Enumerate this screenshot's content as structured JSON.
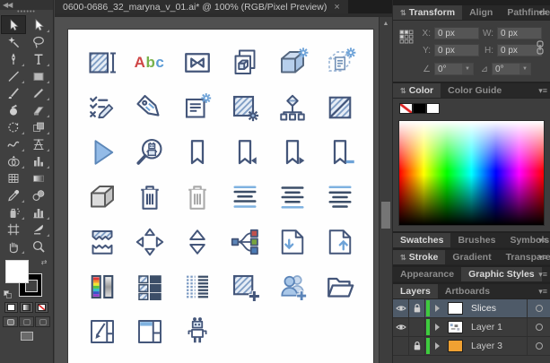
{
  "tab_bar": {
    "title": "0600-0686_32_maryna_v_01.ai* @ 100% (RGB/Pixel Preview)",
    "close": "×"
  },
  "glyphs": {
    "collapse_left": "◀◀",
    "grip": "••••••",
    "panel_collapse": "⇅",
    "panel_menu": "▾≡",
    "scroll_up": "▲",
    "dropdown": "▼",
    "rotate_glyph": "∠",
    "shear_glyph": "⊿",
    "swap": "⇄"
  },
  "toolbar": {
    "active_tool": "selection",
    "tools": [
      "selection",
      "direct-selection",
      "magic-wand",
      "lasso",
      "pen",
      "type",
      "line-segment",
      "rectangle",
      "paintbrush",
      "pencil",
      "blob-brush",
      "eraser",
      "rotate",
      "free-transform",
      "width",
      "perspective-grid",
      "shape-builder",
      "column-graph",
      "mesh",
      "gradient",
      "eyedropper",
      "blend",
      "symbol-sprayer",
      "graph",
      "artboard",
      "slice",
      "hand",
      "zoom"
    ],
    "fill_color": "#ffffff",
    "stroke_color": "#000000"
  },
  "canvas": {
    "abc": {
      "a": "A",
      "b": "b",
      "c": "c"
    },
    "icons": [
      "artboard-measure",
      "text-abc",
      "bowtie-frame",
      "duplicate-pages",
      "cube-settings",
      "cube-document-settings",
      "task-list-edit",
      "tag-edit",
      "document-settings",
      "swatch-settings",
      "hierarchy",
      "swatch-disabled",
      "play",
      "search-robot",
      "bookmark",
      "bookmark-previous",
      "bookmark-next",
      "bookmark-remove",
      "cube-3d",
      "trash",
      "trash-disabled",
      "align-center-selected",
      "align-center-underline",
      "align-center-topline",
      "page-break",
      "move",
      "collapse-vertical",
      "split-channels",
      "page-download",
      "page-upload",
      "color-bars",
      "tile-grid",
      "line-pattern",
      "swatch-add",
      "users-add",
      "folder-open",
      "scale-window",
      "layout-panels",
      "robot"
    ]
  },
  "panels": {
    "transform": {
      "tabs": [
        "Transform",
        "Align",
        "Pathfinder"
      ],
      "active": "Transform",
      "x_label": "X:",
      "x_value": "0 px",
      "y_label": "Y:",
      "y_value": "0 px",
      "w_label": "W:",
      "w_value": "0 px",
      "h_label": "H:",
      "h_value": "0 px",
      "rotate_value": "0°",
      "shear_value": "0°"
    },
    "color": {
      "tabs": [
        "Color",
        "Color Guide"
      ],
      "active": "Color"
    },
    "swatches_bar": {
      "tabs": [
        "Swatches",
        "Brushes",
        "Symbols"
      ],
      "active": "Swatches"
    },
    "stroke_bar": {
      "tabs": [
        "Stroke",
        "Gradient",
        "Transparency"
      ],
      "active": "Stroke"
    },
    "appearance_bar": {
      "tabs": [
        "Appearance",
        "Graphic Styles"
      ],
      "active": "Graphic Styles"
    },
    "layers": {
      "tabs": [
        "Layers",
        "Artboards"
      ],
      "active": "Layers",
      "rows": [
        {
          "name": "Slices",
          "visible": true,
          "locked": true,
          "selected": true,
          "color": "#3ecb3e",
          "thumb": "white"
        },
        {
          "name": "Layer 1",
          "visible": true,
          "locked": false,
          "selected": false,
          "color": "#3ecb3e",
          "thumb": "art"
        },
        {
          "name": "Layer 3",
          "visible": false,
          "locked": true,
          "selected": false,
          "color": "#3ecb3e",
          "thumb": "#f0a132"
        }
      ]
    }
  },
  "colors": {
    "ui_bg": "#3f3f3f",
    "panel_bg": "#3d3d3d",
    "strip_bg": "#282828",
    "selected_row": "#4e5a68",
    "layer_green": "#3ecb3e",
    "layer_orange": "#f0a132",
    "icon_navy": "#44567a",
    "icon_blue": "#6ea3d8",
    "icon_fill": "#b7cfec"
  }
}
